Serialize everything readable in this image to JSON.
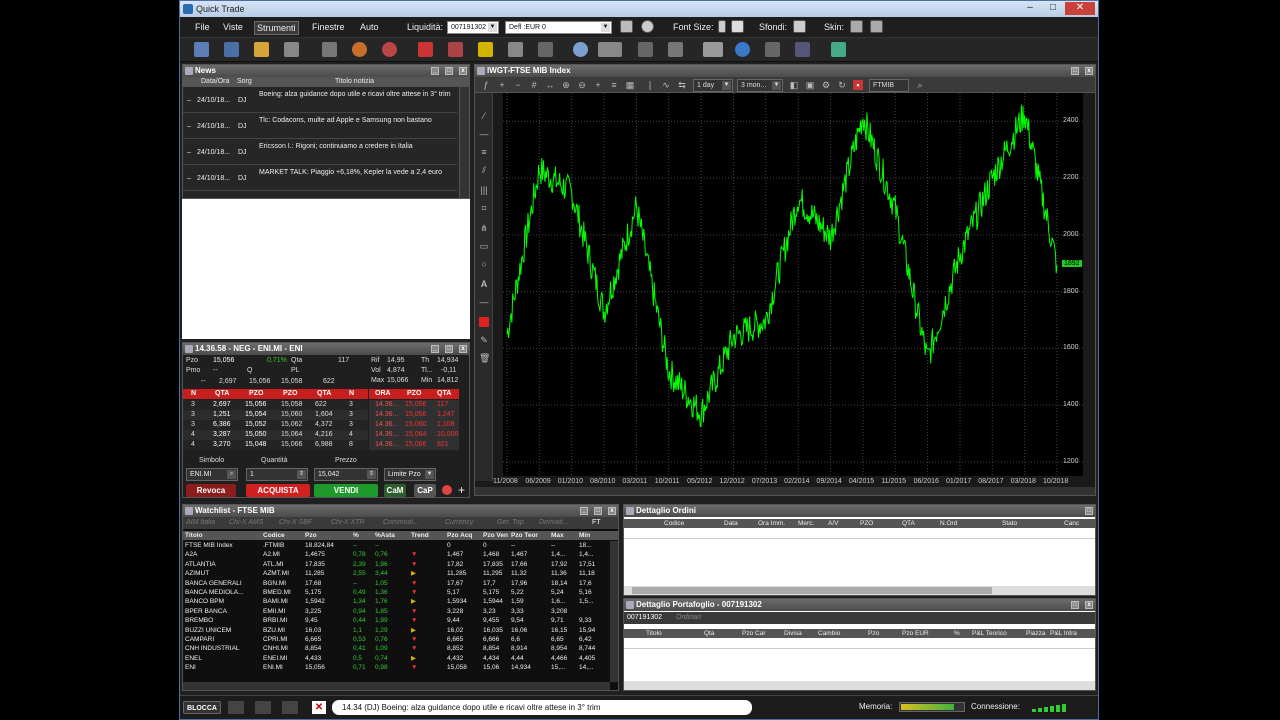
{
  "window": {
    "title": "Quick Trade"
  },
  "menu": {
    "file": "File",
    "viste": "Viste",
    "strumenti": "Strumenti",
    "finestre": "Finestre",
    "auto": "Auto",
    "liquidita_label": "Liquidità:",
    "liquidita_value": "007191302",
    "defl_value": "Defl :EUR 0",
    "font_size_label": "Font Size:",
    "sfondi_label": "Sfondi:",
    "skin_label": "Skin:"
  },
  "news": {
    "title": "News",
    "col_date": "Data/Ora",
    "col_src": "Sorg",
    "col_title": "Titolo notizia",
    "rows": [
      {
        "date": "24/10/18...",
        "src": "DJ",
        "title": "Boeing: alza guidance dopo utile e ricavi oltre attese in 3° trim"
      },
      {
        "date": "24/10/18...",
        "src": "DJ",
        "title": "Tlc: Codacons, multe ad Apple e Samsung non bastano"
      },
      {
        "date": "24/10/18...",
        "src": "DJ",
        "title": "Ericsson I.: Rigoni; continuiamo a credere in Italia"
      },
      {
        "date": "24/10/18...",
        "src": "DJ",
        "title": "MARKET TALK: Piaggio +6,18%, Kepler la vede a 2,4 euro"
      }
    ]
  },
  "chart": {
    "title": "IWGT-FTSE MIB Index",
    "interval": "1 day",
    "range": "3 mon...",
    "symbol": "FTMIB",
    "y_ticks": [
      "2400",
      "2200",
      "2000",
      "1800",
      "1600",
      "1400",
      "1200"
    ],
    "x_ticks": [
      "11/2008",
      "06/2009",
      "01/2010",
      "08/2010",
      "03/2011",
      "10/2011",
      "05/2012",
      "12/2012",
      "07/2013",
      "02/2014",
      "09/2014",
      "04/2015",
      "11/2015",
      "06/2016",
      "01/2017",
      "08/2017",
      "03/2018",
      "10/2018"
    ],
    "last_marker": "1892",
    "color": "#00ff00"
  },
  "chart_data": {
    "type": "line",
    "title": "",
    "xlabel": "",
    "ylabel": "",
    "ylim": [
      1150,
      2500
    ],
    "x": [
      "11/2008",
      "06/2009",
      "01/2010",
      "08/2010",
      "03/2011",
      "10/2011",
      "05/2012",
      "12/2012",
      "07/2013",
      "02/2014",
      "09/2014",
      "04/2015",
      "11/2015",
      "06/2016",
      "01/2017",
      "08/2017",
      "03/2018",
      "10/2018"
    ],
    "series": [
      {
        "values": [
          1650,
          2230,
          2150,
          1730,
          2100,
          1520,
          1370,
          1640,
          1700,
          2130,
          1990,
          2420,
          2090,
          1560,
          1930,
          2200,
          2430,
          1892
        ]
      }
    ]
  },
  "book": {
    "title": "14.36.58 - NEG - ENI.MI - ENI",
    "pzo_label": "Pzo",
    "pzo_value": "15,056",
    "var_value": "0,71%",
    "qta_label": "Qta",
    "qta_value": "117",
    "rif_label": "Rif",
    "rif_value": "14,95",
    "th_label": "Th",
    "th_value": "14,934",
    "pmo_label": "Pmo",
    "pmo_value": "--",
    "q_label": "Q",
    "pl_label": "PL",
    "vol_label": "Vol",
    "vol_value": "4,874",
    "tl_label": "Tl...",
    "tl_value": "-0,11",
    "max_label": "Max",
    "max_value": "15,066",
    "min_label": "Min",
    "min_value": "14,812",
    "summary": [
      "--",
      "2,697",
      "15,056",
      "15,058",
      "622"
    ],
    "heads_bid": [
      "N",
      "QTA",
      "PZO",
      "PZO",
      "QTA",
      "N"
    ],
    "heads_trade": [
      "ORA",
      "PZO",
      "QTA"
    ],
    "rows": [
      [
        "3",
        "2,697",
        "15,056",
        "15,058",
        "622",
        "3",
        "14.36...",
        "15,056",
        "117"
      ],
      [
        "3",
        "1,251",
        "15,054",
        "15,060",
        "1,604",
        "3",
        "14.36...",
        "15,056",
        "1,247"
      ],
      [
        "3",
        "6,386",
        "15,052",
        "15,062",
        "4,372",
        "3",
        "14.36...",
        "15,060",
        "1,108"
      ],
      [
        "4",
        "3,287",
        "15,050",
        "15,064",
        "4,216",
        "4",
        "14.36...",
        "15,064",
        "10,000"
      ],
      [
        "4",
        "3,270",
        "15,048",
        "15,066",
        "6,988",
        "8",
        "14.36...",
        "15,066",
        "821"
      ]
    ],
    "simbolo_label": "Simbolo",
    "quantita_label": "Quantità",
    "prezzo_label": "Prezzo",
    "simbolo_value": "ENI.MI",
    "quantita_value": "1",
    "prezzo_value": "15,042",
    "limit_value": "Limite Pzo",
    "revoca": "Revoca",
    "acquista": "ACQUISTA",
    "vendi": "VENDI",
    "cam": "CaM",
    "cap": "CaP"
  },
  "watchlist": {
    "title": "Watchlist - FTSE MIB",
    "tabs": [
      "AIM Italia",
      "Chi-X AMS",
      "Chi-X SBF",
      "Chi-X XTR",
      "Commodi...",
      "Currency",
      "Ger. Top",
      "Derivati...",
      "FT"
    ],
    "headers": [
      "Titolo",
      "Codice",
      "Pzo",
      "%",
      "%Asta",
      "Trend",
      "Pzo Acq",
      "Pzo Ven",
      "Pzo Teor",
      "Max",
      "Min"
    ],
    "rows": [
      [
        "FTSE MIB Index",
        ".FTMIB",
        "18.824,84",
        "--",
        "--",
        "",
        "0",
        "0",
        "--",
        "--",
        "18..."
      ],
      [
        "A2A",
        "A2.MI",
        "1,4675",
        "0,78",
        "0,76",
        "",
        "1,467",
        "1,468",
        "1,467",
        "1,4...",
        "1,4..."
      ],
      [
        "ATLANTIA",
        "ATL.MI",
        "17,835",
        "2,39",
        "1,96",
        "",
        "17,82",
        "17,835",
        "17,66",
        "17,92",
        "17,51"
      ],
      [
        "AZIMUT",
        "AZMT.MI",
        "11,285",
        "2,55",
        "3,44",
        "",
        "11,285",
        "11,295",
        "11,32",
        "11,36",
        "11,18"
      ],
      [
        "BANCA GENERALI",
        "BGN.MI",
        "17,68",
        "--",
        "1,05",
        "",
        "17,67",
        "17,7",
        "17,96",
        "18,14",
        "17,6"
      ],
      [
        "BANCA MEDIOLA...",
        "BMED.MI",
        "5,175",
        "0,49",
        "1,36",
        "",
        "5,17",
        "5,175",
        "5,22",
        "5,24",
        "5,16"
      ],
      [
        "BANCO BPM",
        "BAMI.MI",
        "1,5942",
        "1,34",
        "1,76",
        "",
        "1,5934",
        "1,5944",
        "1,59",
        "1,6...",
        "1,5..."
      ],
      [
        "BPER BANCA",
        "EMII.MI",
        "3,225",
        "0,94",
        "1,85",
        "",
        "3,228",
        "3,23",
        "3,33",
        "3,208",
        ""
      ],
      [
        "BREMBO",
        "BRBI.MI",
        "9,45",
        "0,44",
        "1,99",
        "",
        "9,44",
        "9,455",
        "9,54",
        "9,71",
        "9,33"
      ],
      [
        "BUZZI UNICEM",
        "BZU.MI",
        "16,03",
        "1,1",
        "1,29",
        "",
        "16,02",
        "16,035",
        "16,06",
        "16,15",
        "15,94"
      ],
      [
        "CAMPARI",
        "CPRI.MI",
        "6,665",
        "0,53",
        "0,76",
        "",
        "6,665",
        "6,666",
        "6,6",
        "6,65",
        "6,42"
      ],
      [
        "CNH INDUSTRIAL",
        "CNHI.MI",
        "8,854",
        "0,41",
        "1,09",
        "",
        "8,852",
        "8,854",
        "8,914",
        "8,954",
        "8,744"
      ],
      [
        "ENEL",
        "ENEI.MI",
        "4,433",
        "0,5",
        "0,74",
        "",
        "4,432",
        "4,434",
        "4,44",
        "4,466",
        "4,405"
      ],
      [
        "ENI",
        "ENI.MI",
        "15,056",
        "0,71",
        "0,98",
        "",
        "15,058",
        "15,06",
        "14,934",
        "15,...",
        "14,..."
      ]
    ]
  },
  "orders": {
    "title": "Dettaglio Ordini",
    "headers": [
      "Codice",
      "Data",
      "Ora Imm.",
      "Merc.",
      "A/V",
      "PZO",
      "QTA",
      "N.Ord",
      "Stato",
      "Canc"
    ]
  },
  "portfolio": {
    "title": "Dettaglio Portafoglio - 007191302",
    "tabs": [
      "007191302",
      "Ordinari"
    ],
    "headers": [
      "Titolo",
      "Qta",
      "Pzo Car",
      "Divisa",
      "Cambio",
      "Pzo",
      "Pzo EUR",
      "%",
      "P&L Teorico",
      "Piazza",
      "P&L Intra"
    ]
  },
  "status": {
    "blocca": "BLOCCA",
    "ticker": "14.34 (DJ) Boeing: alza guidance dopo utile e ricavi oltre attese in 3° trim",
    "memoria_label": "Memoria:",
    "memoria_fill": 0.85,
    "connessione_label": "Connessione:"
  }
}
